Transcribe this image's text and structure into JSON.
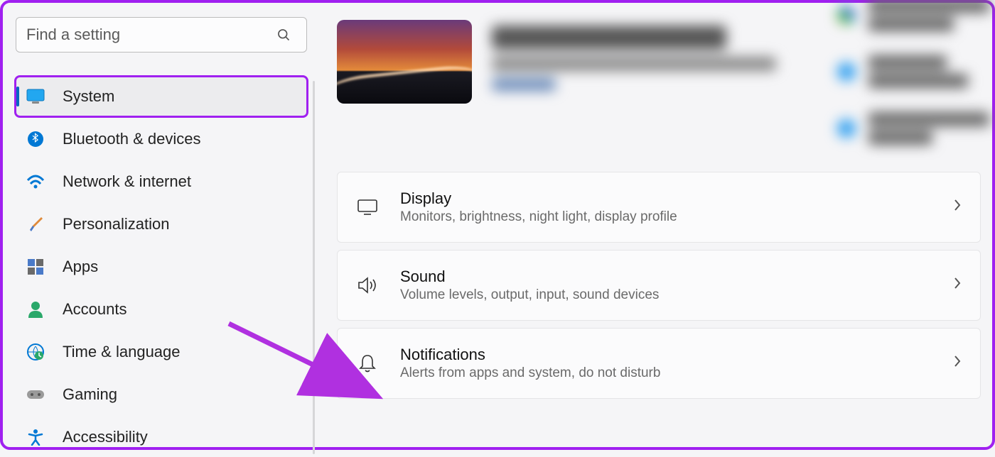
{
  "search": {
    "placeholder": "Find a setting"
  },
  "sidebar": {
    "items": [
      {
        "label": "System"
      },
      {
        "label": "Bluetooth & devices"
      },
      {
        "label": "Network & internet"
      },
      {
        "label": "Personalization"
      },
      {
        "label": "Apps"
      },
      {
        "label": "Accounts"
      },
      {
        "label": "Time & language"
      },
      {
        "label": "Gaming"
      },
      {
        "label": "Accessibility"
      }
    ],
    "selectedIndex": 0
  },
  "main": {
    "cards": [
      {
        "title": "Display",
        "subtitle": "Monitors, brightness, night light, display profile"
      },
      {
        "title": "Sound",
        "subtitle": "Volume levels, output, input, sound devices"
      },
      {
        "title": "Notifications",
        "subtitle": "Alerts from apps and system, do not disturb"
      }
    ]
  },
  "annotation": {
    "highlight_sidebar": "System",
    "arrow_target": "Notifications"
  }
}
